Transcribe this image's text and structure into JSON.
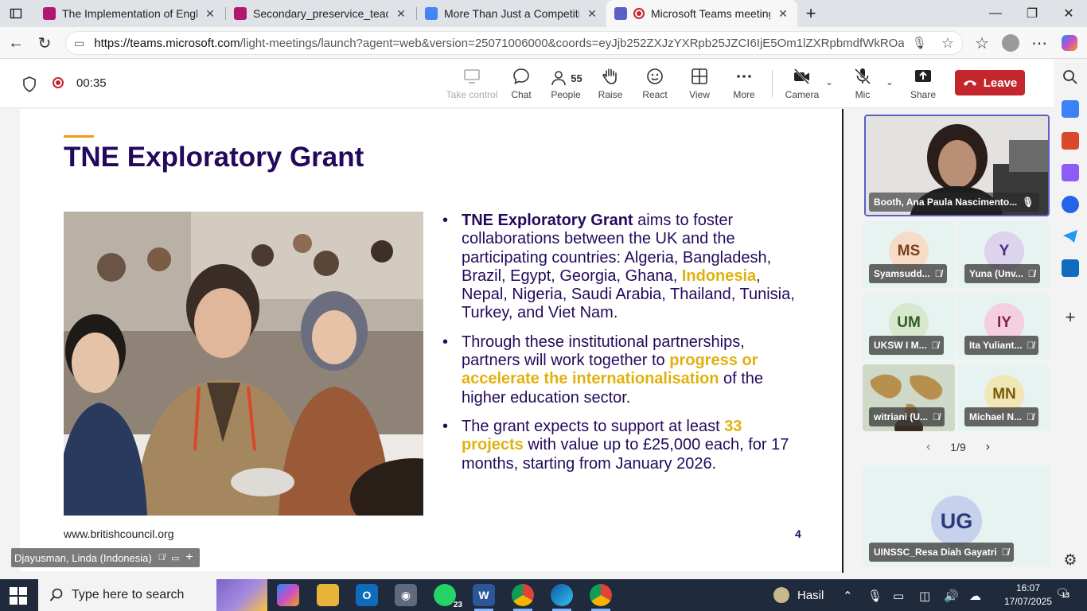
{
  "browser": {
    "tabs": [
      {
        "title": "The Implementation of English Le",
        "color": "#b0176f"
      },
      {
        "title": "Secondary_preservice_teachers_C",
        "color": "#b0176f"
      },
      {
        "title": "More Than Just a Competition: A",
        "color": "#4285f4"
      },
      {
        "title": "Microsoft Teams meeting | M",
        "color": "#5b5fc7"
      }
    ],
    "url_domain": "https://teams.microsoft.com",
    "url_path": "/light-meetings/launch?agent=web&version=25071006000&coords=eyJjb252ZXJzYXRpb25JZCI6IjE5Om1lZXRpbmdfWkROa09ETTJZVGt..."
  },
  "meeting": {
    "timer": "00:35",
    "toolbar": {
      "take_control": "Take control",
      "chat": "Chat",
      "people": "People",
      "people_count": "55",
      "raise": "Raise",
      "react": "React",
      "view": "View",
      "more": "More",
      "camera": "Camera",
      "mic": "Mic",
      "share": "Share",
      "leave": "Leave"
    }
  },
  "slide": {
    "title": "TNE Exploratory Grant",
    "bullet1_strong": "TNE Exploratory Grant",
    "bullet1_a": " aims to foster collaborations between the UK and the participating countries: Algeria, Bangladesh, Brazil, Egypt, Georgia, Ghana, ",
    "bullet1_hl": "Indonesia",
    "bullet1_b": ", Nepal, Nigeria, Saudi Arabia, Thailand, Tunisia, Turkey, and Viet Nam.",
    "bullet2_a": "Through these institutional partnerships, partners will work together to ",
    "bullet2_hl": "progress or accelerate the internationalisation",
    "bullet2_b": " of the higher education sector.",
    "bullet3_a": "The grant expects to support at least ",
    "bullet3_hl": "33 projects",
    "bullet3_b": " with value up to £25,000 each, for 17 months, starting from January 2026.",
    "footer": "www.britishcouncil.org",
    "page_number": "4"
  },
  "presenter_tag": "Djayusman, Linda (Indonesia)",
  "participants": {
    "main_name": "Booth, Ana Paula Nascimento...",
    "tiles": [
      {
        "initials": "MS",
        "name": "Syamsudd...",
        "bg": "#f6dcc7",
        "fg": "#7a3f1a"
      },
      {
        "initials": "Y",
        "name": "Yuna (Unv...",
        "bg": "#dcd3ee",
        "fg": "#4b2b83"
      },
      {
        "initials": "UM",
        "name": "UKSW I M...",
        "bg": "#d7e8cf",
        "fg": "#2f5d22"
      },
      {
        "initials": "IY",
        "name": "Ita Yuliant...",
        "bg": "#f4d0de",
        "fg": "#8a1d4b"
      },
      {
        "initials": "",
        "name": "witriani (U...",
        "bg": "#f1e6b8",
        "fg": "#7a5b00"
      },
      {
        "initials": "MN",
        "name": "Michael N...",
        "bg": "#f1e6b8",
        "fg": "#7a5b00"
      }
    ],
    "pager": "1/9",
    "bottom_initials": "UG",
    "bottom_name": "UINSSC_Resa Diah Gayatri"
  },
  "taskbar": {
    "search_placeholder": "Type here to search",
    "whatsapp_badge": "23",
    "weather": "Hasil",
    "time": "16:07",
    "date": "17/07/2025",
    "notifications": "13"
  }
}
